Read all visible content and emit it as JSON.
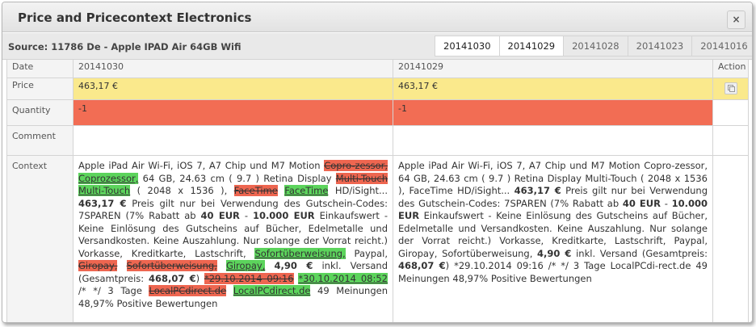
{
  "dialog": {
    "title": "Price and Pricecontext Electronics",
    "close_glyph": "×",
    "source": "Source: 11786 De - Apple IPAD Air 64GB Wifi"
  },
  "tabs": [
    "20141030",
    "20141029",
    "20141028",
    "20141023",
    "20141016"
  ],
  "active_tabs": [
    0,
    1
  ],
  "table": {
    "labels": {
      "date": "Date",
      "price": "Price",
      "quantity": "Quantity",
      "comment": "Comment",
      "context": "Context",
      "action": "Action"
    },
    "columns": [
      {
        "date": "20141030",
        "price": "463,17 €",
        "quantity": "-1",
        "comment": ""
      },
      {
        "date": "20141029",
        "price": "463,17 €",
        "quantity": "-1",
        "comment": ""
      }
    ]
  },
  "context_left": [
    {
      "t": " Apple iPad Air Wi-Fi, iOS 7, A7 Chip und M7 Motion "
    },
    {
      "t": "Copro-zessor,",
      "s": "del"
    },
    {
      "t": " "
    },
    {
      "t": "Coprozessor,",
      "s": "ins"
    },
    {
      "t": " 64 GB, 24.63 cm ( 9.7 ) Retina Display "
    },
    {
      "t": "Multi-Touch",
      "s": "del"
    },
    {
      "t": " "
    },
    {
      "t": "Multi-Touch",
      "s": "ins"
    },
    {
      "t": " ( 2048 x 1536 ), "
    },
    {
      "t": "FaceTime",
      "s": "del"
    },
    {
      "t": " "
    },
    {
      "t": "FaceTime",
      "s": "ins"
    },
    {
      "t": " HD/iSight... "
    },
    {
      "t": "463,17 €",
      "s": "b"
    },
    {
      "t": " Preis gilt nur bei Verwendung des Gutschein-Codes: 7SPAREN (7% Rabatt ab "
    },
    {
      "t": "40 EUR",
      "s": "b"
    },
    {
      "t": " - "
    },
    {
      "t": "10.000 EUR",
      "s": "b"
    },
    {
      "t": " Einkaufswert - Keine Einlösung des Gutscheins auf Bücher, Edelmetalle und Versandkosten. Keine Auszahlung. Nur solange der Vorrat reicht.) Vorkasse, Kreditkarte, Lastschrift, "
    },
    {
      "t": "Sofortüberweisung,",
      "s": "ins"
    },
    {
      "t": " Paypal, "
    },
    {
      "t": "Giropay,",
      "s": "del"
    },
    {
      "t": " "
    },
    {
      "t": "Sofortüberweisung,",
      "s": "del"
    },
    {
      "t": " "
    },
    {
      "t": "Giropay,",
      "s": "ins"
    },
    {
      "t": " "
    },
    {
      "t": "4,90 €",
      "s": "b"
    },
    {
      "t": " inkl. Versand (Gesamtpreis: "
    },
    {
      "t": "468,07 €",
      "s": "b"
    },
    {
      "t": ") "
    },
    {
      "t": "*29.10.2014 09:16",
      "s": "del"
    },
    {
      "t": " "
    },
    {
      "t": "*30.10.2014 08:52",
      "s": "ins"
    },
    {
      "t": " /* */ 3 Tage "
    },
    {
      "t": "LocalPCdirect.de",
      "s": "del"
    },
    {
      "t": " "
    },
    {
      "t": "LocalPCdirect.de",
      "s": "ins"
    },
    {
      "t": " 49 Meinungen 48,97% Positive Bewertungen"
    }
  ],
  "context_right": [
    {
      "t": " Apple iPad Air Wi-Fi, iOS 7, A7 Chip und M7 Motion Copro-zessor, 64 GB, 24.63 cm ( 9.7 ) Retina Display Multi-Touch ( 2048 x 1536 ), FaceTime HD/iSight... "
    },
    {
      "t": "463,17 €",
      "s": "b"
    },
    {
      "t": " Preis gilt nur bei Verwendung des Gutschein-Codes: 7SPAREN (7% Rabatt ab "
    },
    {
      "t": "40 EUR",
      "s": "b"
    },
    {
      "t": " - "
    },
    {
      "t": "10.000 EUR",
      "s": "b"
    },
    {
      "t": " Einkaufswert - Keine Einlösung des Gutscheins auf Bücher, Edelmetalle und Versandkosten. Keine Auszahlung. Nur solange der Vorrat reicht.) Vorkasse, Kreditkarte, Lastschrift, Paypal, Giropay, Sofortüberweisung, "
    },
    {
      "t": "4,90 €",
      "s": "b"
    },
    {
      "t": " inkl. Versand (Gesamtpreis: "
    },
    {
      "t": "468,07 €",
      "s": "b"
    },
    {
      "t": ") *29.10.2014 09:16 /* */ 3 Tage LocalPCdi-rect.de 49 Meinungen 48,97% Positive Bewertungen"
    }
  ],
  "colors": {
    "price_row": "#fae98c",
    "quantity_row": "#f26d54",
    "removed_text": "#ee6650",
    "added_text": "#5cd45c"
  },
  "icons": {
    "action": "copy-icon",
    "close": "close-icon"
  }
}
